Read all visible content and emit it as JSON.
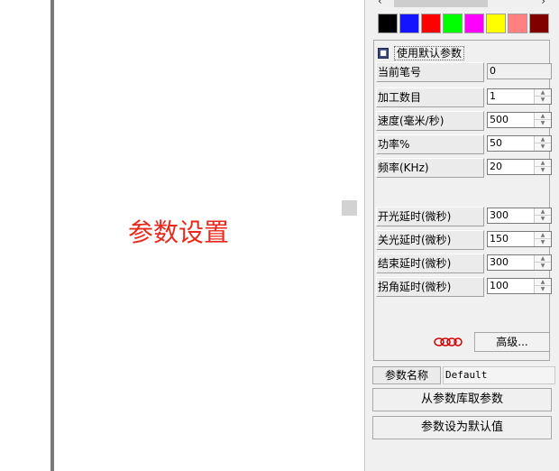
{
  "canvas": {
    "annotation_text": "参数设置"
  },
  "palette": {
    "swatches": [
      "#000000",
      "#1414ff",
      "#ff0000",
      "#00ff00",
      "#ff00ff",
      "#ffff00",
      "#ff8080",
      "#800000"
    ]
  },
  "params": {
    "use_default_label": "使用默认参数",
    "rows": [
      {
        "label": "当前笔号",
        "value": "0"
      },
      {
        "label": "加工数目",
        "value": "1"
      },
      {
        "label": "速度(毫米/秒)",
        "value": "500"
      },
      {
        "label": "功率%",
        "value": "50"
      },
      {
        "label": "频率(KHz)",
        "value": "20"
      },
      {
        "label": "开光延时(微秒)",
        "value": "300"
      },
      {
        "label": "关光延时(微秒)",
        "value": "150"
      },
      {
        "label": "结束延时(微秒)",
        "value": "300"
      },
      {
        "label": "拐角延时(微秒)",
        "value": "100"
      }
    ],
    "advanced_label": "高级..."
  },
  "param_name": {
    "label": "参数名称",
    "value": "Default"
  },
  "buttons": {
    "load_from_library": "从参数库取参数",
    "set_as_default": "参数设为默认值"
  }
}
